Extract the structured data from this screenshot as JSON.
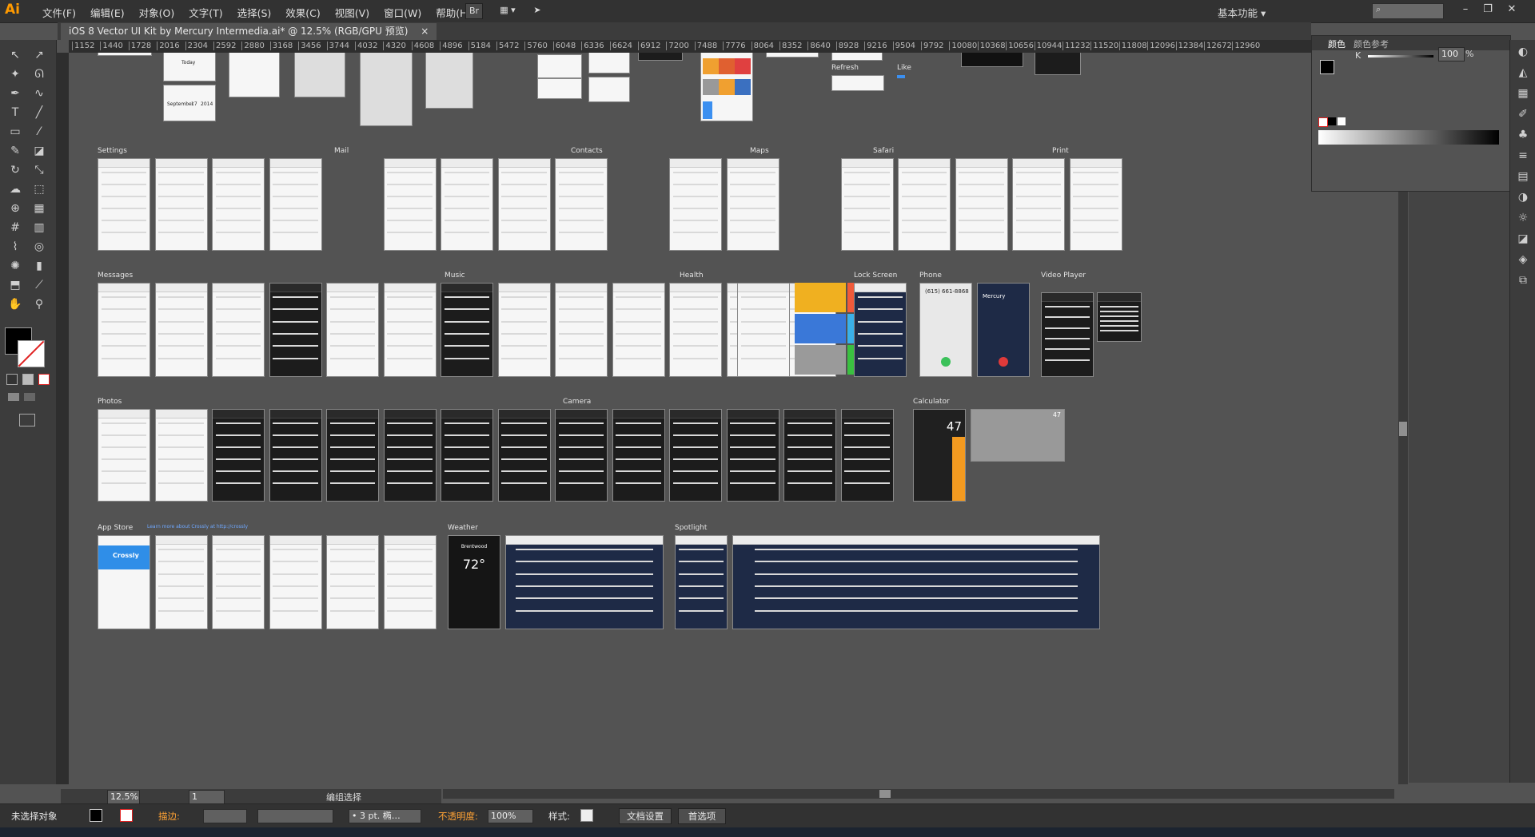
{
  "app": {
    "logo": "Ai",
    "workspace": "基本功能 ▾"
  },
  "menu": [
    "文件(F)",
    "编辑(E)",
    "对象(O)",
    "文字(T)",
    "选择(S)",
    "效果(C)",
    "视图(V)",
    "窗口(W)",
    "帮助(H)"
  ],
  "menu_buttons": {
    "bridge": "Br",
    "arrange": "▦ ▾",
    "send": "➤"
  },
  "window_controls": {
    "minimize": "–",
    "restore": "❐",
    "close": "✕"
  },
  "doc_tab": {
    "title": "iOS 8 Vector UI Kit by Mercury Intermedia.ai* @ 12.5% (RGB/GPU 预览)",
    "close": "×"
  },
  "ruler_ticks": [
    "1152",
    "1440",
    "1728",
    "2016",
    "2304",
    "2592",
    "2880",
    "3168",
    "3456",
    "3744",
    "4032",
    "4320",
    "4608",
    "4896",
    "5184",
    "5472",
    "5760",
    "6048",
    "6336",
    "6624",
    "6912",
    "7200",
    "7488",
    "7776",
    "8064",
    "8352",
    "8640",
    "8928",
    "9216",
    "9504",
    "9792",
    "10080",
    "10368",
    "10656",
    "10944",
    "11232",
    "11520",
    "11808",
    "12096",
    "12384",
    "12672",
    "12960"
  ],
  "sections": {
    "settings": "Settings",
    "mail": "Mail",
    "contacts": "Contacts",
    "maps": "Maps",
    "safari": "Safari",
    "print": "Print",
    "messages": "Messages",
    "music": "Music",
    "health": "Health",
    "lock_screen": "Lock Screen",
    "phone": "Phone",
    "video_player": "Video Player",
    "photos": "Photos",
    "camera": "Camera",
    "calculator": "Calculator",
    "app_store": "App Store",
    "weather": "Weather",
    "spotlight": "Spotlight",
    "refresh": "Refresh",
    "like": "Like"
  },
  "screen_texts": {
    "phone_number": "(615) 661-8868",
    "caller": "Mercury",
    "calc_value": "47",
    "calc_value_2": "47",
    "weather_city": "Brentwood",
    "weather_temp": "72°",
    "crossly": "Crossly",
    "app_store_link": "Learn more about Crossly at http://crossly",
    "calendar_month": "September",
    "calendar_day": "17",
    "calendar_year": "2014",
    "today": "Today"
  },
  "colors_panel": {
    "tab1": "颜色",
    "tab2": "颜色参考",
    "k_label": "K",
    "k_value": "100",
    "percent": "%"
  },
  "status": {
    "zoom": "12.5%",
    "page": "1",
    "label": "编组选择"
  },
  "control_bar": {
    "selection": "未选择对象",
    "stroke_label": "描边:",
    "stroke_value": "",
    "brush": "• 3 pt. 椭…",
    "opacity_label": "不透明度:",
    "opacity_value": "100%",
    "style_label": "样式:",
    "doc_setup": "文档设置",
    "preferences": "首选项"
  },
  "accent_colors": {
    "ai_orange": "#ff9a00",
    "ios_blue": "#3b8ff0",
    "panel_bg": "#535353",
    "chrome_dark": "#323232"
  }
}
